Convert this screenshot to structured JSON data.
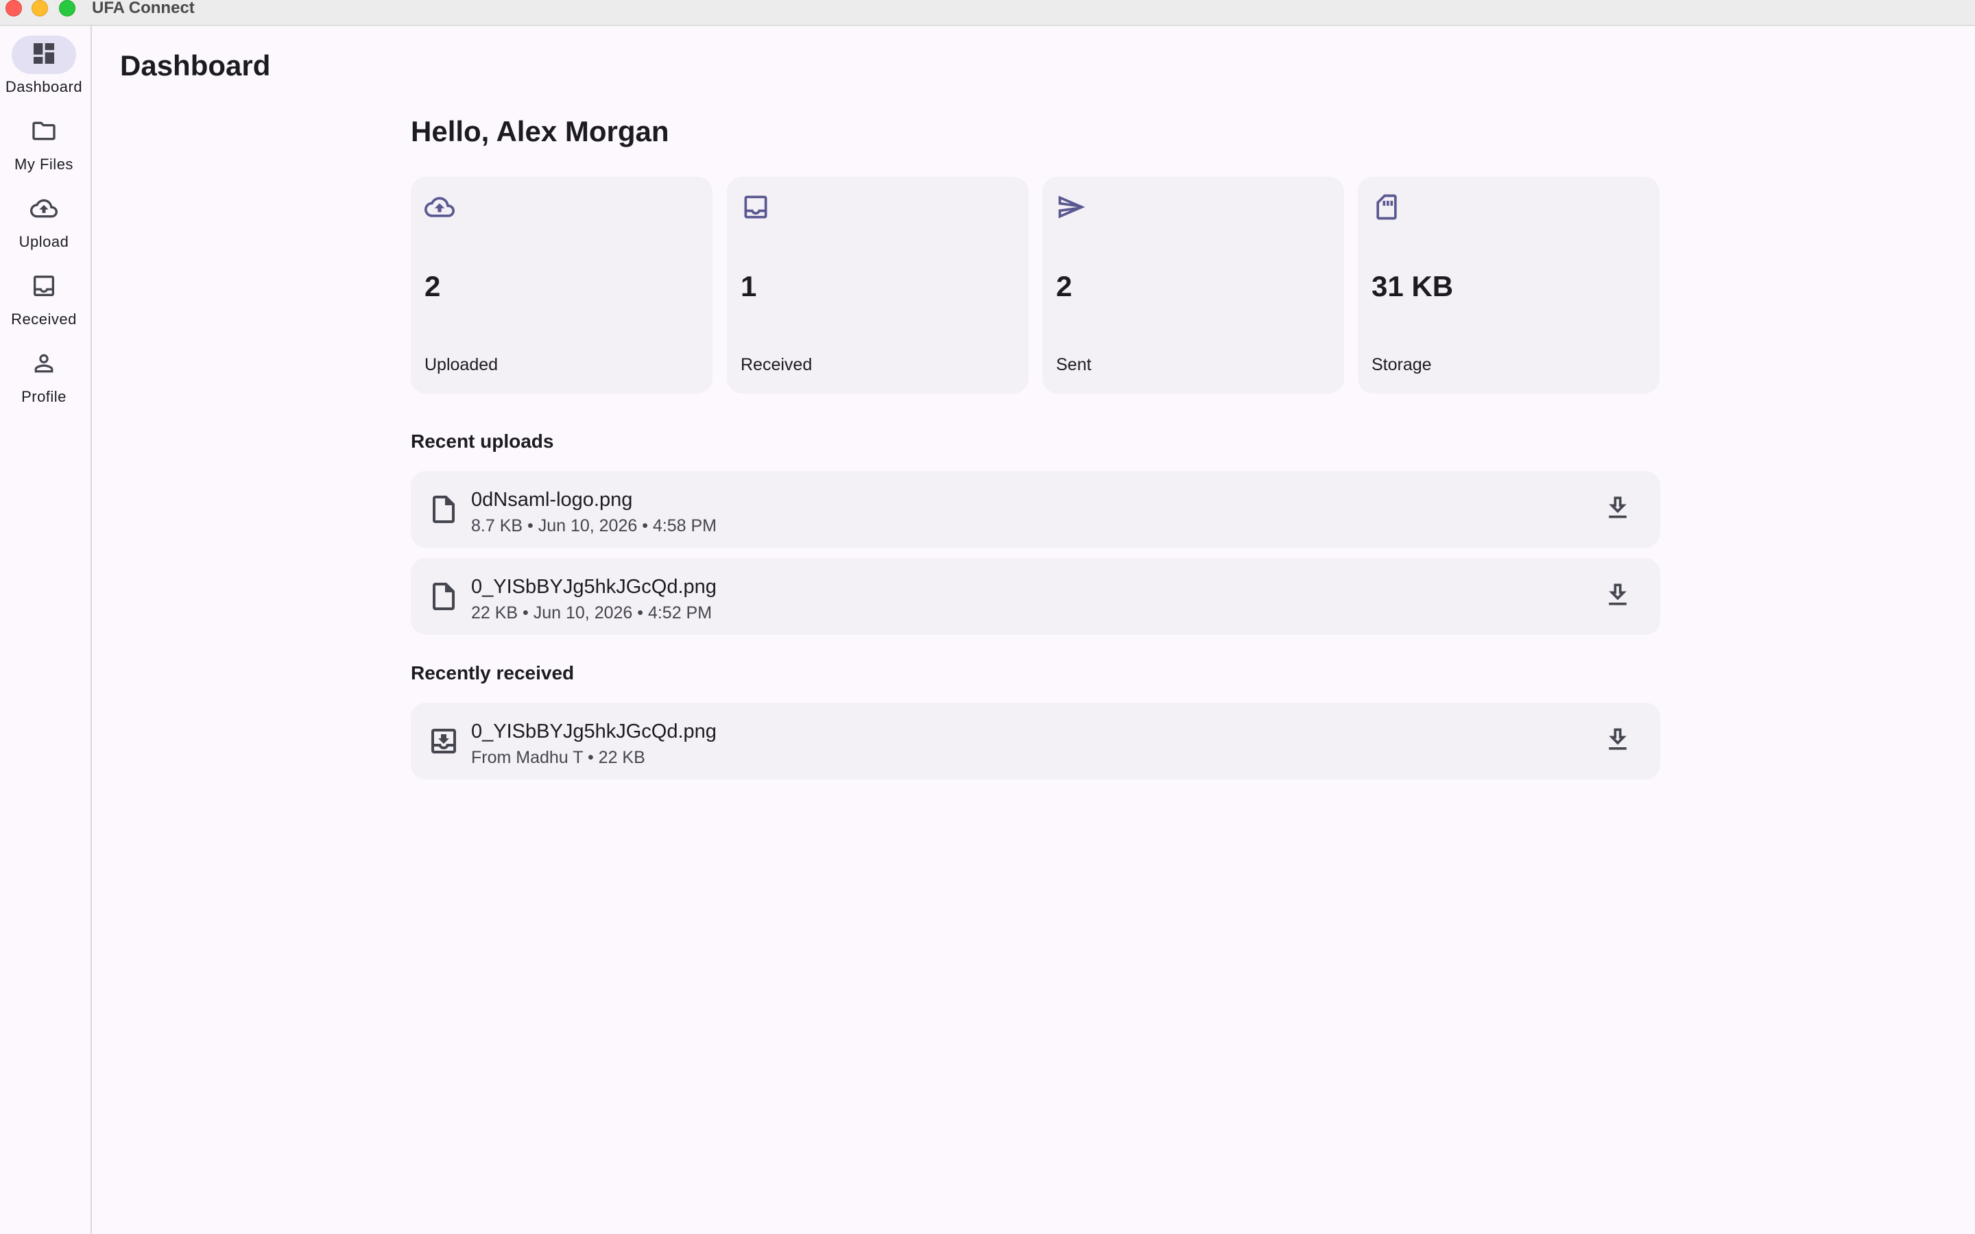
{
  "window": {
    "title": "UFA Connect"
  },
  "nav": {
    "items": [
      {
        "label": "Dashboard",
        "icon": "dashboard-icon",
        "active": true
      },
      {
        "label": "My Files",
        "icon": "folder-icon",
        "active": false
      },
      {
        "label": "Upload",
        "icon": "cloud-upload-icon",
        "active": false
      },
      {
        "label": "Received",
        "icon": "inbox-icon",
        "active": false
      },
      {
        "label": "Profile",
        "icon": "person-icon",
        "active": false
      }
    ]
  },
  "page": {
    "title": "Dashboard",
    "greeting": "Hello, Alex Morgan"
  },
  "stats": [
    {
      "value": "2",
      "label": "Uploaded",
      "icon": "cloud-upload-icon"
    },
    {
      "value": "1",
      "label": "Received",
      "icon": "inbox-icon"
    },
    {
      "value": "2",
      "label": "Sent",
      "icon": "send-icon"
    },
    {
      "value": "31 KB",
      "label": "Storage",
      "icon": "sd-card-icon"
    }
  ],
  "recent_uploads": {
    "title": "Recent uploads",
    "items": [
      {
        "name": "0dNsaml-logo.png",
        "meta": "8.7 KB • Jun 10, 2026 • 4:58 PM",
        "icon": "file-icon"
      },
      {
        "name": "0_YISbBYJg5hkJGcQd.png",
        "meta": "22 KB • Jun 10, 2026 • 4:52 PM",
        "icon": "file-icon"
      }
    ]
  },
  "recently_received": {
    "title": "Recently received",
    "items": [
      {
        "name": "0_YISbBYJg5hkJGcQd.png",
        "meta": "From Madhu T • 22 KB",
        "icon": "move-to-inbox-icon"
      }
    ]
  },
  "colors": {
    "accent": "#5a5890",
    "active_pill": "#e3e0f4",
    "card_bg": "#f3f0f6",
    "background": "#fcf8fd"
  }
}
